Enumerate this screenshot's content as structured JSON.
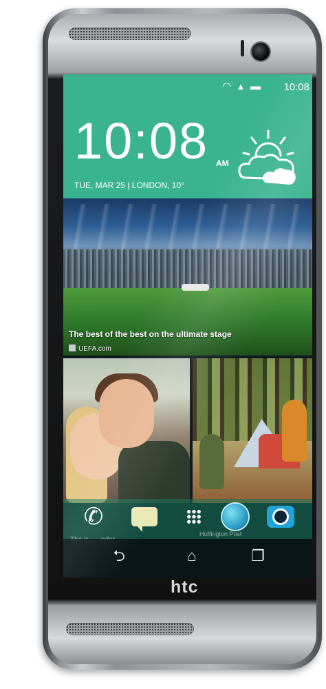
{
  "device": {
    "brand_logo": "htc",
    "icons": {
      "speaker_top": "speaker-grille-icon",
      "speaker_bottom": "speaker-grille-icon",
      "front_camera": "front-camera-icon"
    }
  },
  "status_bar": {
    "time": "10:08",
    "icons": [
      "wifi-icon",
      "signal-icon",
      "battery-icon"
    ],
    "icon_glyphs": "◠ ▴ ▬"
  },
  "clock_widget": {
    "time": "10:08",
    "ampm": "AM",
    "date_location": "TUE, MAR 25 | LONDON, 10°",
    "weather_icon": "partly-cloudy-icon",
    "background_color": "#3ab48f"
  },
  "news_card": {
    "headline": "The best of the best on the ultimate stage",
    "source": "UEFA.com",
    "source_icon": "source-icon"
  },
  "photo_tiles": [
    {
      "name": "couple-photo",
      "caption": "The Ir... ...nder..."
    },
    {
      "name": "camping-photo",
      "caption": "Huffington Post"
    }
  ],
  "dock": [
    {
      "name": "phone-app",
      "icon": "phone-icon",
      "glyph": "✆"
    },
    {
      "name": "messages-app",
      "icon": "message-bubble-icon"
    },
    {
      "name": "all-apps",
      "icon": "apps-grid-icon"
    },
    {
      "name": "browser-app",
      "icon": "globe-icon"
    },
    {
      "name": "camera-app",
      "icon": "camera-icon"
    }
  ],
  "nav_bar": {
    "back": "⮌",
    "home": "⌂",
    "recent": "❐"
  }
}
